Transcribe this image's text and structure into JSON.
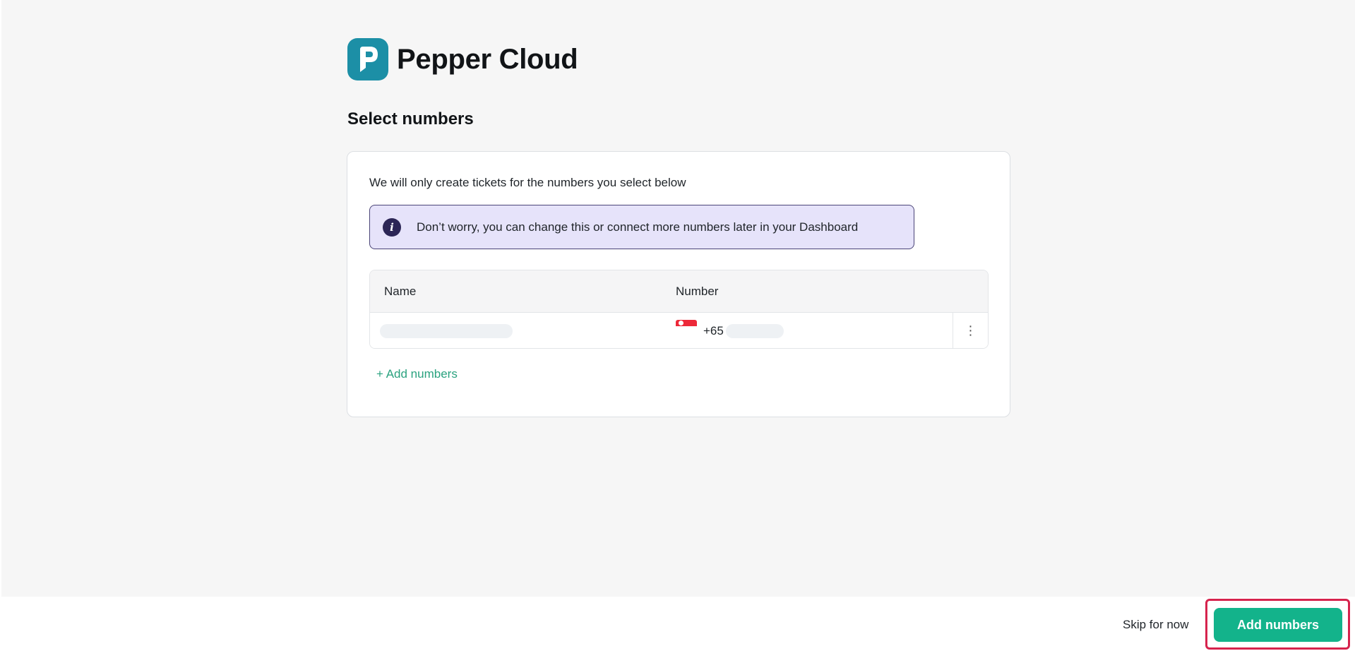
{
  "brand": {
    "name": "Pepper Cloud",
    "logo_icon": "pepper-cloud-logo-icon",
    "color": "#1c8fa6"
  },
  "page": {
    "title": "Select numbers"
  },
  "card": {
    "intro": "We will only create tickets for the numbers you select below",
    "info_banner": {
      "icon": "info-icon",
      "text": "Don’t worry, you can change this or connect more numbers later in your Dashboard"
    },
    "table": {
      "headers": {
        "name": "Name",
        "number": "Number"
      },
      "rows": [
        {
          "flag": "singapore-flag-icon",
          "dial_code": "+65",
          "menu_icon": "more-vertical-icon"
        }
      ]
    },
    "add_link": "+ Add numbers"
  },
  "footer": {
    "skip_label": "Skip for now",
    "primary_label": "Add numbers",
    "accent_color": "#13b38b",
    "highlight_color": "#d6234d"
  }
}
